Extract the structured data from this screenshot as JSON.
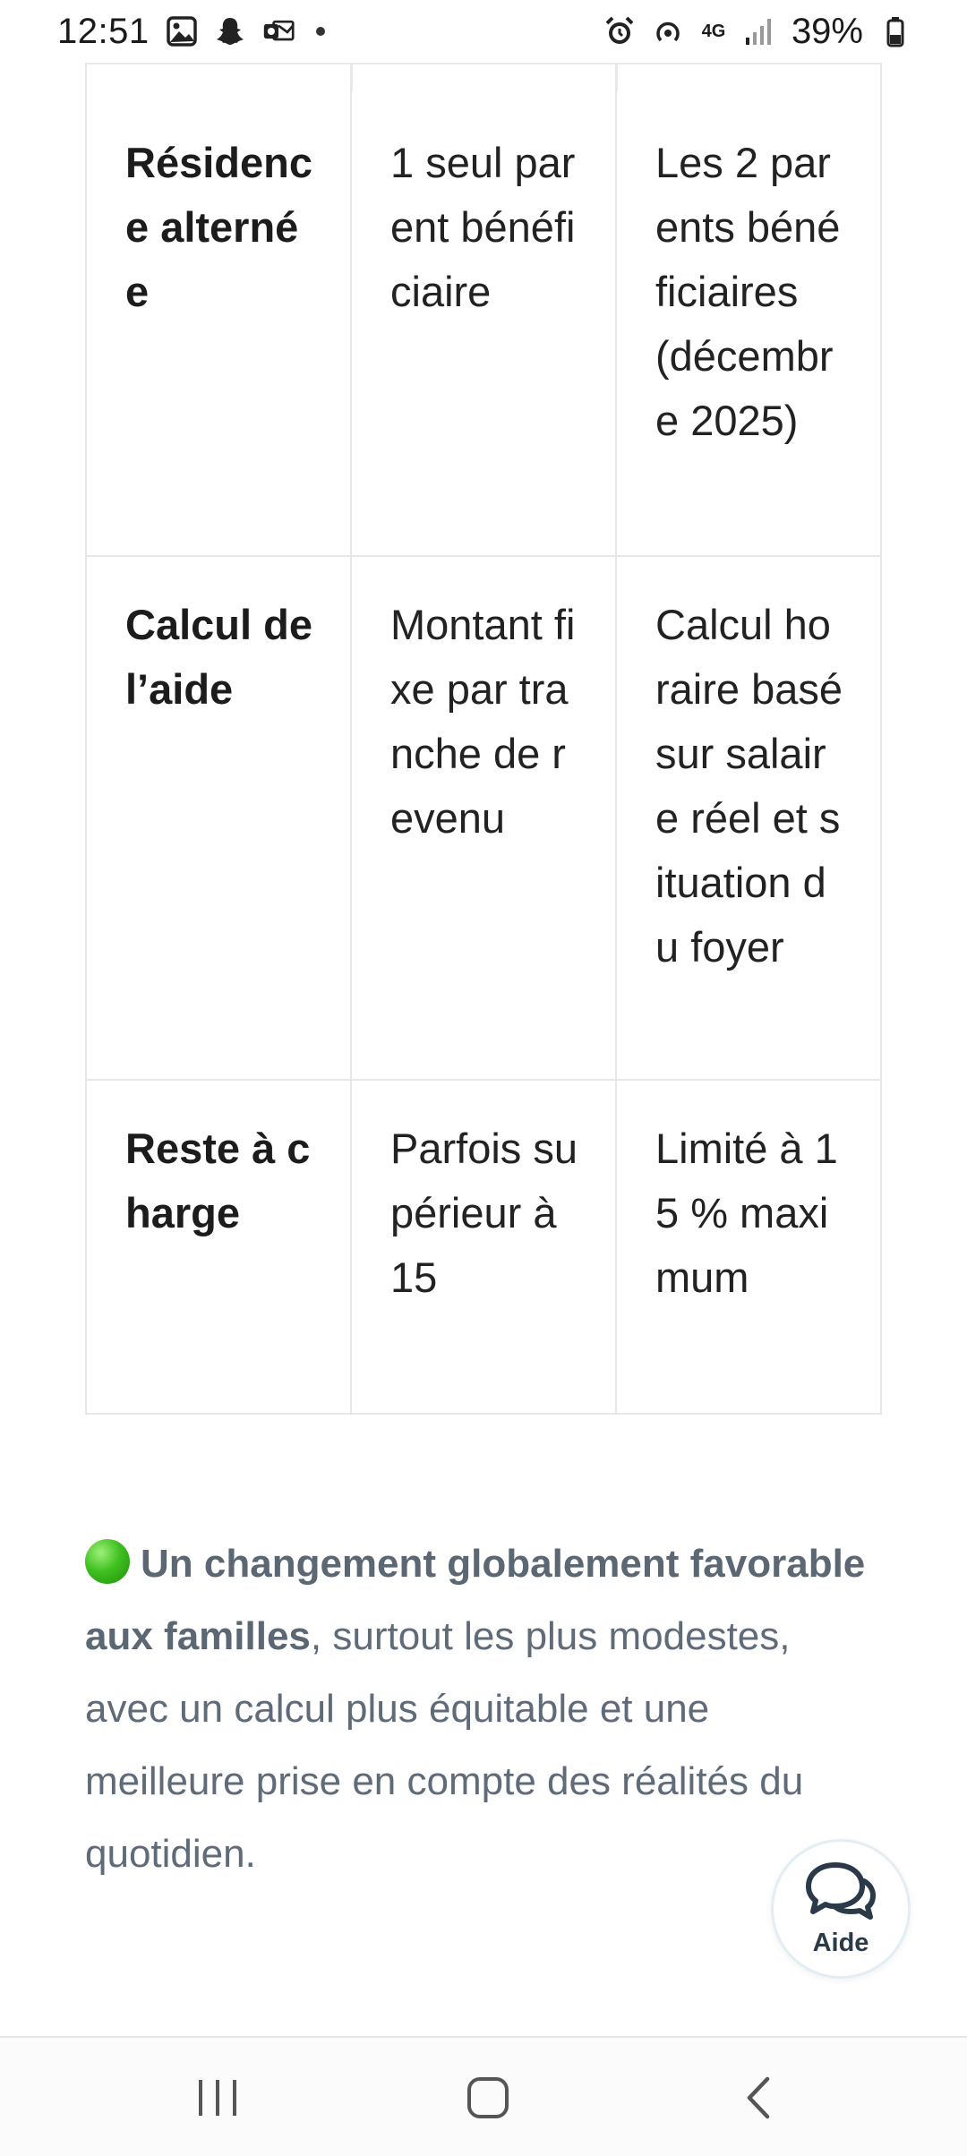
{
  "status_bar": {
    "time": "12:51",
    "left_icons": [
      "gallery-icon",
      "snapchat-icon",
      "outlook-icon",
      "more-dot-icon"
    ],
    "network": "4G",
    "battery": "39%"
  },
  "table": {
    "rows": [
      {
        "label": "Résidence alternée",
        "col1": "1 seul parent bénéficiaire",
        "col2": "Les 2 parents bénéficiaires (décembre 2025)"
      },
      {
        "label": "Calcul de l’aide",
        "col1": "Montant fixe par tranche de revenu",
        "col2": "Calcul horaire basé sur salaire réel et situation du foyer"
      },
      {
        "label": "Reste à charge",
        "col1": "Parfois supérieur à 15",
        "col2": "Limité à 15 % maximum"
      }
    ]
  },
  "summary": {
    "bold": "Un changement globalement favorable aux familles",
    "rest": ", surtout les plus modestes, avec un calcul plus équitable et une meilleure prise en compte des réalités du quotidien."
  },
  "help": {
    "label": "Aide"
  },
  "colors": {
    "text_muted": "#5f6b78",
    "border": "#e8e8e8",
    "green": "#3fc01f"
  }
}
